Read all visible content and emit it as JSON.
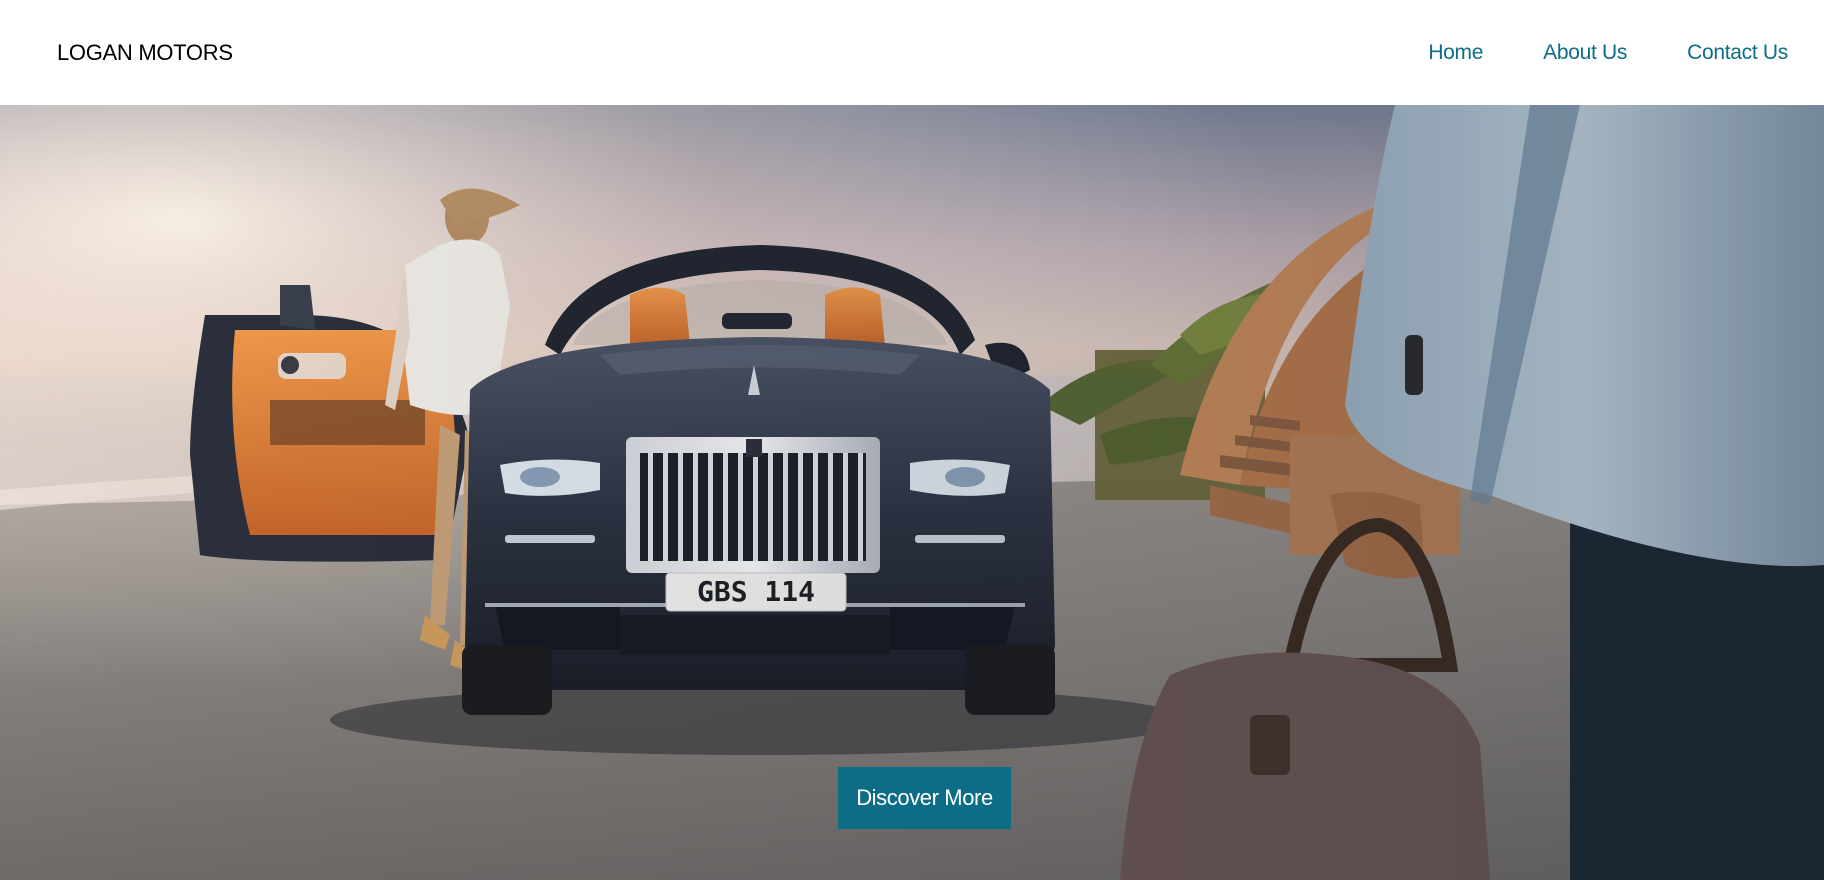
{
  "header": {
    "brand": "LOGAN MOTORS",
    "nav": [
      {
        "label": "Home"
      },
      {
        "label": "About Us"
      },
      {
        "label": "Contact Us"
      }
    ]
  },
  "hero": {
    "plate_text": "GBS 114",
    "cta_label": "Discover More"
  },
  "colors": {
    "accent": "#0d6d87",
    "nav_link": "#0b6d87",
    "header_bg": "#ffffff"
  }
}
